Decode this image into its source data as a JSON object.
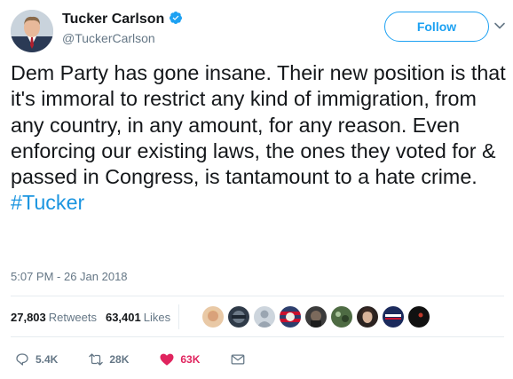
{
  "author": {
    "name": "Tucker Carlson",
    "handle": "@TuckerCarlson",
    "verified": true
  },
  "follow_button": {
    "label": "Follow"
  },
  "tweet": {
    "text": "Dem Party has gone insane. Their new position is that it's immoral to restrict any kind of immigration, from any country, in any amount, for any reason. Even enforcing our existing laws, the ones they voted for & passed in Congress, is tantamount to a hate crime.",
    "hashtag": "#Tucker",
    "timestamp": "5:07 PM - 26 Jan 2018"
  },
  "stats": {
    "retweets": {
      "count": "27,803",
      "label": "Retweets"
    },
    "likes": {
      "count": "63,401",
      "label": "Likes"
    }
  },
  "actions": {
    "reply": {
      "icon": "reply-icon",
      "count": "5.4K"
    },
    "retweet": {
      "icon": "retweet-icon",
      "count": "28K"
    },
    "like": {
      "icon": "heart-icon",
      "count": "63K"
    },
    "message": {
      "icon": "envelope-icon"
    }
  },
  "colors": {
    "accent": "#1da1f2",
    "hashtag": "#1b95e0",
    "like": "#e0245e",
    "muted": "#657786"
  }
}
